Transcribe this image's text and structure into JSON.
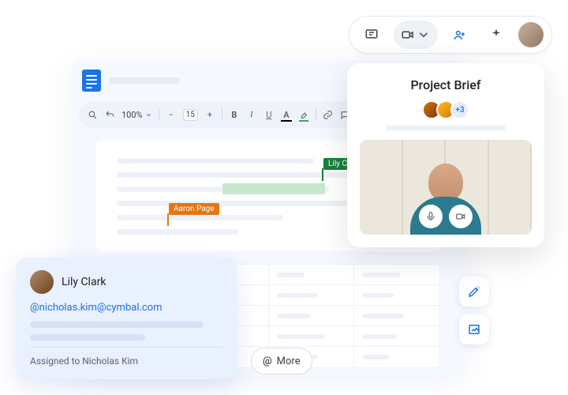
{
  "topbar": {
    "icons": [
      "chat",
      "camera",
      "people",
      "sparkle"
    ]
  },
  "toolbar": {
    "zoom": "100%",
    "font_size": "15",
    "bold": "B",
    "italic": "I",
    "underline": "U"
  },
  "cursors": {
    "green": {
      "label": "Lily Clark",
      "color": "#188038"
    },
    "orange": {
      "label": "Aaron Page",
      "color": "#e8740c"
    }
  },
  "meet": {
    "title": "Project Brief",
    "more_count": "+3"
  },
  "comment": {
    "author": "Lily Clark",
    "mention": "@nicholas.kim@cymbal.com",
    "assigned": "Assigned to Nicholas Kim"
  },
  "more_button": "More"
}
